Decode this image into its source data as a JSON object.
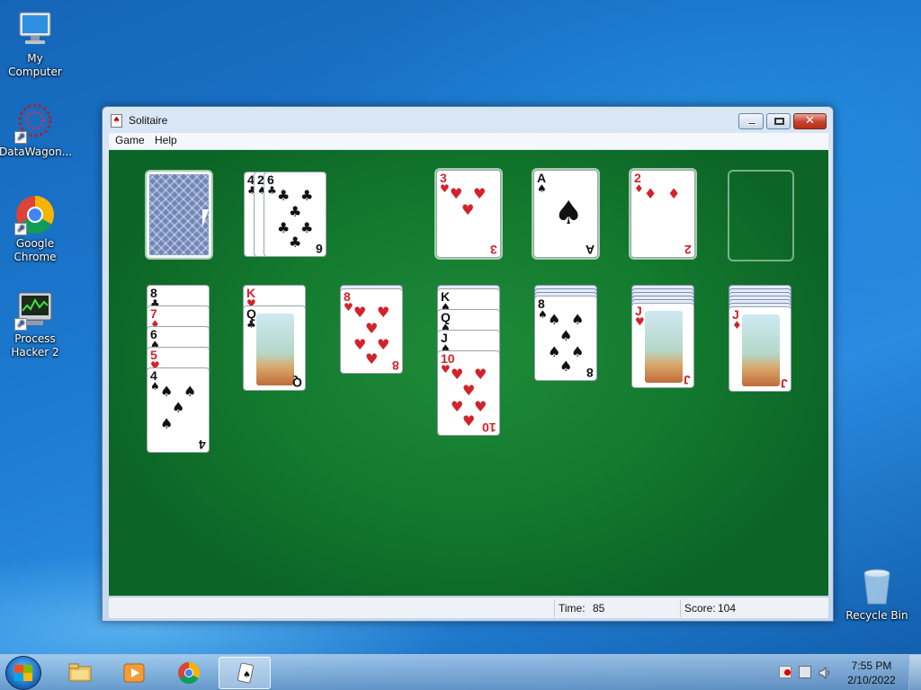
{
  "desktop": {
    "icons": [
      {
        "label": "My Computer"
      },
      {
        "label": "DataWagon..."
      },
      {
        "label": "Google Chrome"
      },
      {
        "label": "Process Hacker 2"
      },
      {
        "label": "Recycle Bin"
      }
    ]
  },
  "window": {
    "title": "Solitaire",
    "menu": {
      "game": "Game",
      "help": "Help"
    },
    "status": {
      "time_label": "Time:",
      "time": "85",
      "score_label": "Score:",
      "score": "104"
    }
  },
  "game": {
    "stock": {
      "face_down": true
    },
    "waste": [
      {
        "rank": "4",
        "suit": "♣"
      },
      {
        "rank": "2",
        "suit": "♠"
      },
      {
        "rank": "6",
        "suit": "♣"
      }
    ],
    "foundations": [
      {
        "rank": "3",
        "suit": "♥"
      },
      {
        "rank": "A",
        "suit": "♠"
      },
      {
        "rank": "2",
        "suit": "♦"
      },
      null
    ],
    "tableau": [
      {
        "hidden": 0,
        "cards": [
          {
            "rank": "8",
            "suit": "♣"
          },
          {
            "rank": "7",
            "suit": "♦"
          },
          {
            "rank": "6",
            "suit": "♠"
          },
          {
            "rank": "5",
            "suit": "♥"
          },
          {
            "rank": "4",
            "suit": "♠"
          }
        ]
      },
      {
        "hidden": 0,
        "cards": [
          {
            "rank": "K",
            "suit": "♥"
          },
          {
            "rank": "Q",
            "suit": "♣"
          }
        ]
      },
      {
        "hidden": 1,
        "cards": [
          {
            "rank": "8",
            "suit": "♥"
          }
        ]
      },
      {
        "hidden": 1,
        "cards": [
          {
            "rank": "K",
            "suit": "♠"
          },
          {
            "rank": "Q",
            "suit": "♠"
          },
          {
            "rank": "J",
            "suit": "♠"
          },
          {
            "rank": "10",
            "suit": "♥"
          }
        ]
      },
      {
        "hidden": 3,
        "cards": [
          {
            "rank": "8",
            "suit": "♠"
          }
        ]
      },
      {
        "hidden": 5,
        "cards": [
          {
            "rank": "J",
            "suit": "♥"
          }
        ]
      },
      {
        "hidden": 6,
        "cards": [
          {
            "rank": "J",
            "suit": "♦"
          }
        ]
      }
    ]
  },
  "taskbar": {
    "items": [
      {
        "icon": "windows-explorer-icon"
      },
      {
        "icon": "media-player-icon"
      },
      {
        "icon": "chrome-icon"
      },
      {
        "icon": "solitaire-icon"
      }
    ],
    "clock": {
      "time": "7:55 PM",
      "date": "2/10/2022"
    }
  }
}
